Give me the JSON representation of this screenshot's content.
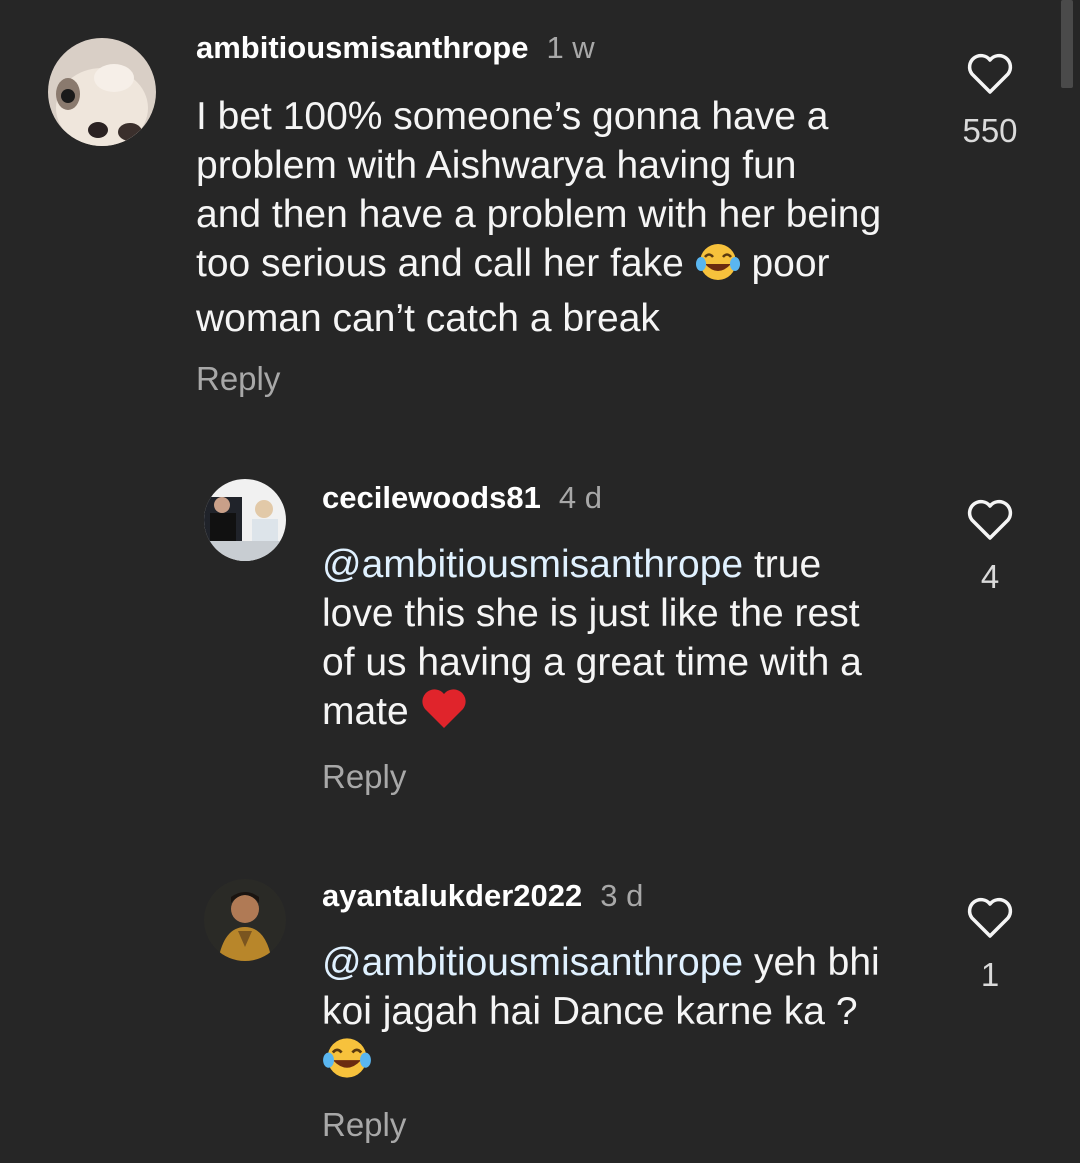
{
  "comments": [
    {
      "username": "ambitiousmisanthrope",
      "time": "1 w",
      "text_lines": [
        "I bet 100% someone’s gonna have a",
        "problem with Aishwarya having fun",
        "and then have a problem with her being",
        "too serious and call her fake",
        "woman can’t catch a break"
      ],
      "line4_after_emoji": " poor",
      "emoji": "joy",
      "likes": "550",
      "reply_label": "Reply",
      "avatar_icon": "dog-avatar"
    },
    {
      "username": "cecilewoods81",
      "time": "4 d",
      "mention": "@ambitiousmisanthrope",
      "text_lines": [
        " true",
        "love this she is just like the rest",
        "of us having a great time with a",
        "mate"
      ],
      "emoji": "red-heart",
      "likes": "4",
      "reply_label": "Reply",
      "avatar_icon": "couple-photo-avatar"
    },
    {
      "username": "ayantalukder2022",
      "time": "3 d",
      "mention": "@ambitiousmisanthrope",
      "text_lines": [
        " yeh bhi",
        "koi jagah hai Dance karne ka ?"
      ],
      "emoji": "joy",
      "likes": "1",
      "reply_label": "Reply",
      "avatar_icon": "man-photo-avatar"
    }
  ],
  "colors": {
    "background": "#262626",
    "username": "#ffffff",
    "secondary": "#a8a8a8",
    "mention": "#e0f1ff"
  }
}
